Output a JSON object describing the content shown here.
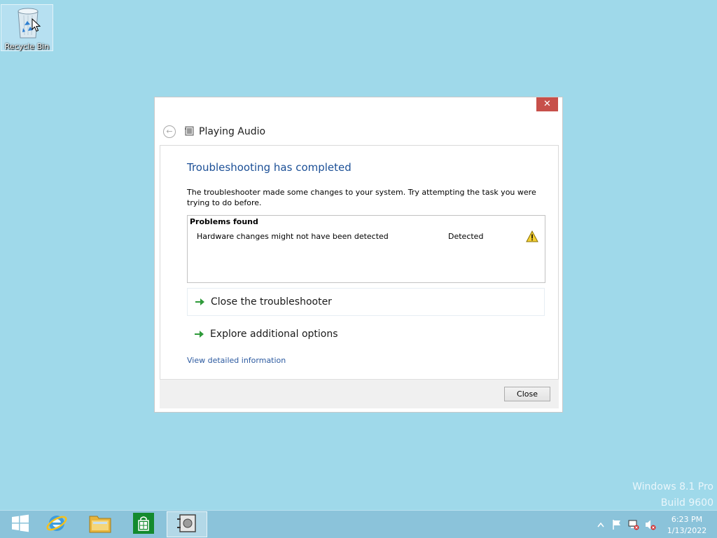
{
  "desktop": {
    "recycle_bin_label": "Recycle Bin"
  },
  "watermark": {
    "line1": "Windows 8.1 Pro",
    "line2": "Build 9600"
  },
  "dialog": {
    "close_glyph": "✕",
    "title": "Playing Audio",
    "heading": "Troubleshooting has completed",
    "description": "The troubleshooter made some changes to your system. Try attempting the task you were trying to do before.",
    "problems": {
      "header": "Problems found",
      "rows": [
        {
          "name": "Hardware changes might not have been detected",
          "status": "Detected",
          "icon": "warning-icon"
        }
      ]
    },
    "options": [
      {
        "label": "Close the troubleshooter",
        "icon": "green-arrow-icon"
      },
      {
        "label": "Explore additional options",
        "icon": "green-arrow-icon"
      }
    ],
    "detail_link": "View detailed information",
    "footer_close": "Close"
  },
  "taskbar": {
    "items": [
      "start-button",
      "internet-explorer",
      "file-explorer",
      "store",
      "troubleshooter"
    ],
    "active_item": "troubleshooter"
  },
  "tray": {
    "time": "6:23 PM",
    "date": "1/13/2022"
  },
  "colors": {
    "desktop_bg": "#9fd9ea",
    "taskbar_bg": "#8bc3da",
    "close_red": "#c7504a",
    "heading_blue": "#1b4f96",
    "link_blue": "#2c5aa0"
  }
}
